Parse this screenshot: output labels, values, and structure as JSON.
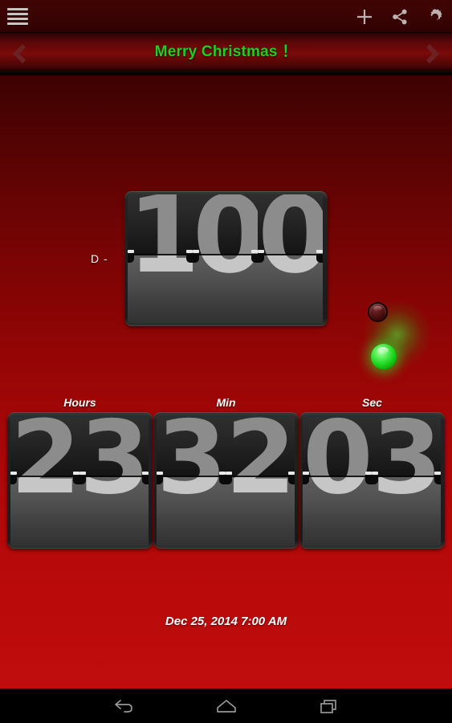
{
  "app": {
    "theme_bg_top": "#3d0202",
    "theme_bg_bottom": "#c00c0c",
    "accent_green": "#22cc22"
  },
  "actionbar": {
    "menu_icon": "hamburger-menu-icon",
    "icons": [
      {
        "name": "add-icon",
        "label": "Add"
      },
      {
        "name": "share-icon",
        "label": "Share"
      },
      {
        "name": "settings-gear-icon",
        "label": "Settings"
      }
    ]
  },
  "titlebar": {
    "title": "Merry Christmas ！",
    "prev_label": "Previous",
    "next_label": "Next"
  },
  "countdown": {
    "days": {
      "label": "D -",
      "digits": [
        "1",
        "0",
        "0"
      ]
    },
    "leds": [
      {
        "name": "status-led-off",
        "state": "off",
        "color": "#5a1616"
      },
      {
        "name": "status-led-on",
        "state": "on",
        "color": "#17d017"
      }
    ],
    "units": [
      {
        "label": "Hours",
        "digits": [
          "2",
          "3"
        ]
      },
      {
        "label": "Min",
        "digits": [
          "3",
          "2"
        ]
      },
      {
        "label": "Sec",
        "digits": [
          "0",
          "3"
        ]
      }
    ],
    "target_date": "Dec 25, 2014 7:00 AM"
  },
  "navbar": {
    "buttons": [
      {
        "name": "back-icon",
        "label": "Back"
      },
      {
        "name": "home-icon",
        "label": "Home"
      },
      {
        "name": "recents-icon",
        "label": "Recent apps"
      }
    ]
  }
}
